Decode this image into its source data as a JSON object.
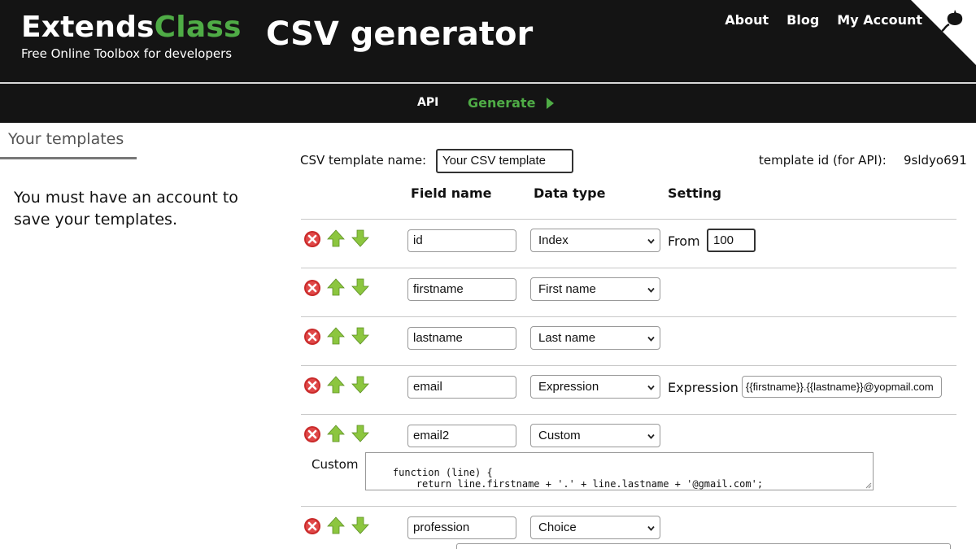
{
  "header": {
    "logo_part1": "Extends",
    "logo_part2": "Class",
    "tagline": "Free Online Toolbox for developers",
    "title": "CSV generator",
    "nav": [
      "About",
      "Blog",
      "My Account"
    ]
  },
  "subnav": {
    "api": "API",
    "generate": "Generate"
  },
  "sidebar": {
    "tab_label": "Your templates",
    "message": "You must have an account to save your templates."
  },
  "form": {
    "template_name_label": "CSV template name:",
    "template_name_value": "Your CSV template",
    "template_id_label": "template id (for API):",
    "template_id_value": "9sldyo691",
    "columns": [
      "Field name",
      "Data type",
      "Setting"
    ]
  },
  "fields": [
    {
      "name": "id",
      "type": "Index",
      "setting_label": "From",
      "setting_value": "100"
    },
    {
      "name": "firstname",
      "type": "First name"
    },
    {
      "name": "lastname",
      "type": "Last name"
    },
    {
      "name": "email",
      "type": "Expression",
      "setting_label": "Expression",
      "setting_value": "{{firstname}}.{{lastname}}@yopmail.com"
    },
    {
      "name": "email2",
      "type": "Custom",
      "custom_label": "Custom",
      "custom_code": "function (line) {\n        return line.firstname + '.' + line.lastname + '@gmail.com';\n}"
    },
    {
      "name": "profession",
      "type": "Choice"
    }
  ],
  "colors": {
    "header_bg": "#141414",
    "accent": "#4fac46",
    "delete": "#c92a2a",
    "arrow": "#8cc63f"
  },
  "icons": [
    "delete-icon",
    "arrow-up-icon",
    "arrow-down-icon",
    "github-icon",
    "chevron-down-icon"
  ]
}
